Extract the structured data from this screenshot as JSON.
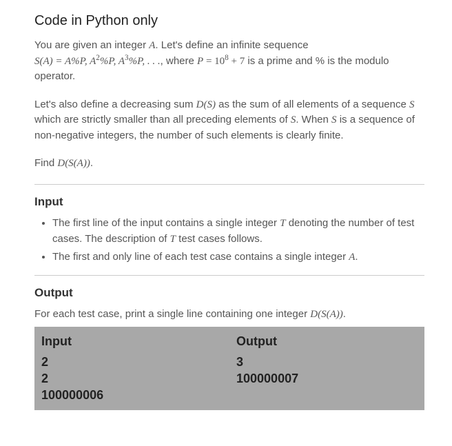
{
  "title": "Code in Python only",
  "intro_lead": "You are given an integer ",
  "intro_A": "A",
  "intro_trail": ". Let's define an infinite sequence",
  "seq_lhs": "S(A) = ",
  "seq_t1": "A%P, A",
  "seq_e2": "2",
  "seq_t2": "%P, A",
  "seq_e3": "3",
  "seq_t3": "%P, . . .",
  "where": ", where ",
  "P": "P",
  "eq": " = 10",
  "exp8": "8",
  "plus7": " + 7",
  "prime_tail": " is a prime and % is the modulo operator.",
  "p2_a": "Let's also define a decreasing sum ",
  "DS": "D(S)",
  "p2_b": " as the sum of all elements of a sequence ",
  "S": "S",
  "p2_c": " which are strictly smaller than all preceding elements of ",
  "p2_d": ". When ",
  "p2_e": " is a sequence of non-negative integers, the number of such elements is clearly finite.",
  "find": "Find ",
  "DSA": "D(S(A))",
  "dot": ".",
  "input_h": "Input",
  "input_li1_a": "The first line of the input contains a single integer ",
  "T": "T",
  "input_li1_b": " denoting the number of test cases. The description of ",
  "input_li1_c": " test cases follows.",
  "input_li2_a": "The first and only line of each test case contains a single integer ",
  "output_h": "Output",
  "output_p_a": "For each test case, print a single line containing one integer ",
  "io": {
    "input_label": "Input",
    "output_label": "Output",
    "input_lines": [
      "2",
      "2",
      "100000006"
    ],
    "output_lines": [
      "3",
      "100000007"
    ]
  }
}
